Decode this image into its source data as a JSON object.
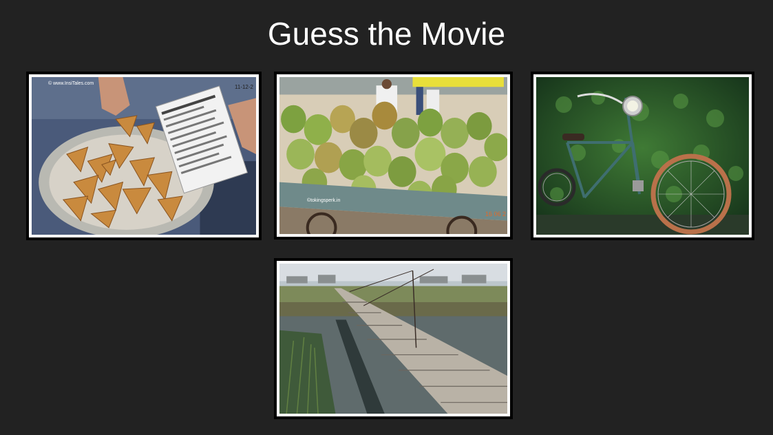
{
  "slide": {
    "title": "Guess the Movie"
  },
  "photos": [
    {
      "name": "samosas",
      "watermark": "© www.InsiTales.com",
      "news_date": "11-12-2"
    },
    {
      "name": "coconuts",
      "watermark": "©tokingsperk.in",
      "stamp": "16 06 2"
    },
    {
      "name": "bicycle"
    },
    {
      "name": "rope-bridge"
    }
  ]
}
